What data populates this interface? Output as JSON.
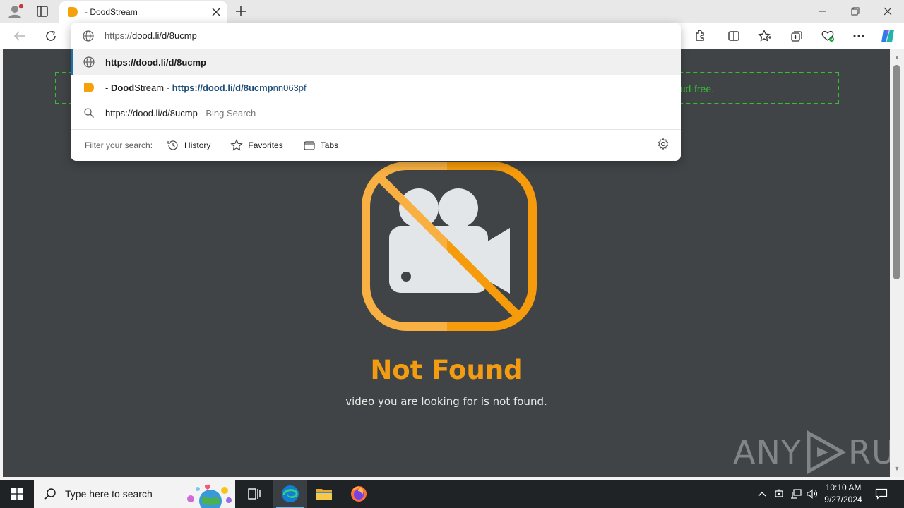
{
  "browser": {
    "tab_title": "- DoodStream",
    "colors": {
      "accent": "#f5a10a",
      "edge_blue": "#1a73a8"
    }
  },
  "omnibox": {
    "typed_prefix": "https://",
    "typed_main": "dood.li/d/8ucmp",
    "suggestions": [
      {
        "type": "url",
        "bold": "https://dood.li/d/8ucmp"
      },
      {
        "type": "history",
        "site_prefix": "- ",
        "site_bold": "Dood",
        "site_rest": "Stream",
        "separator": " - ",
        "url_bold": "https://dood.li/d/8ucmp",
        "url_rest": "nn063pf"
      },
      {
        "type": "search",
        "query": "https://dood.li/d/8ucmp",
        "engine": " - Bing Search"
      }
    ],
    "filter_label": "Filter your search:",
    "filters": [
      "History",
      "Favorites",
      "Tabs"
    ]
  },
  "page": {
    "ad_text": "ud-free.",
    "title": "Not Found",
    "subtitle": "video you are looking for is not found.",
    "watermark_left": "ANY",
    "watermark_right": "RUN",
    "colors": {
      "background": "#414446",
      "title": "#f39c12",
      "ad_border": "#33c030"
    }
  },
  "taskbar": {
    "search_placeholder": "Type here to search",
    "time": "10:10 AM",
    "date": "9/27/2024"
  }
}
